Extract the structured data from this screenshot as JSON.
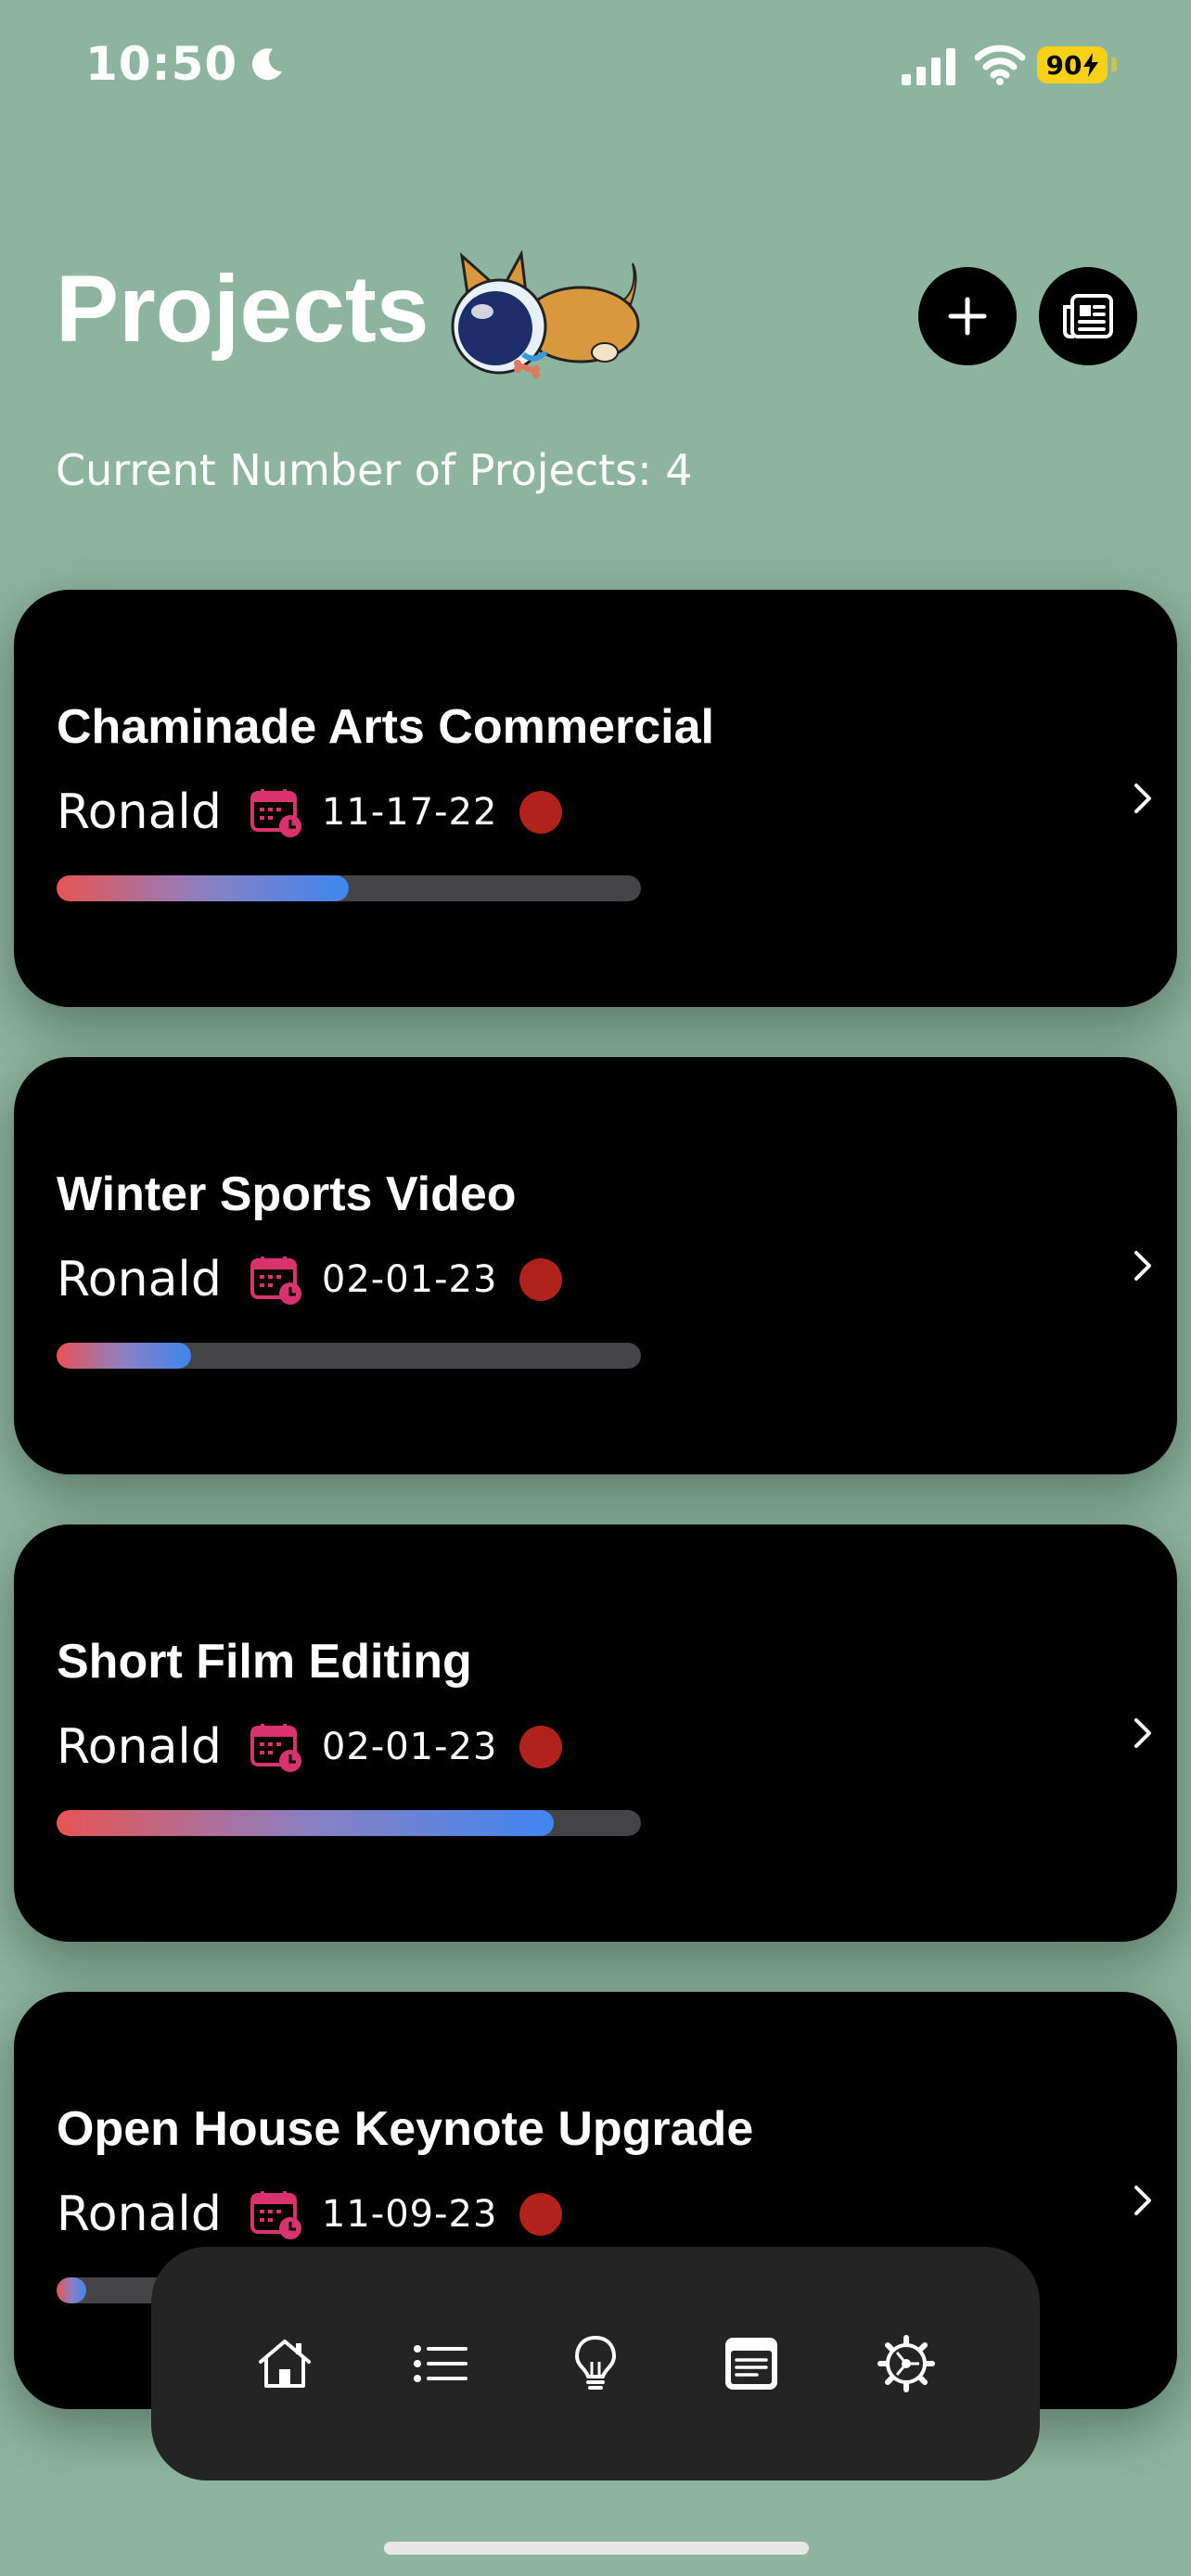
{
  "status_bar": {
    "time": "10:50",
    "battery": "90"
  },
  "header": {
    "title": "Projects",
    "subtitle": "Current Number of Projects: 4"
  },
  "projects": [
    {
      "title": "Chaminade Arts Commercial",
      "owner": "Ronald",
      "due": "11-17-22",
      "progress": 0.5
    },
    {
      "title": "Winter Sports Video",
      "owner": "Ronald",
      "due": "02-01-23",
      "progress": 0.23
    },
    {
      "title": "Short Film Editing",
      "owner": "Ronald",
      "due": "02-01-23",
      "progress": 0.85
    },
    {
      "title": "Open House Keynote Upgrade",
      "owner": "Ronald",
      "due": "11-09-23",
      "progress": 0.05
    }
  ],
  "tab_bar": {
    "items": [
      "home-icon",
      "list-icon",
      "lightbulb-icon",
      "notes-icon",
      "settings-icon"
    ]
  },
  "colors": {
    "background": "#8cb49e",
    "card": "#000000",
    "status_dot": "#b2221d",
    "calendar_icon": "#d8336f",
    "progress_start": "#e85454",
    "progress_end": "#3f86f0"
  }
}
